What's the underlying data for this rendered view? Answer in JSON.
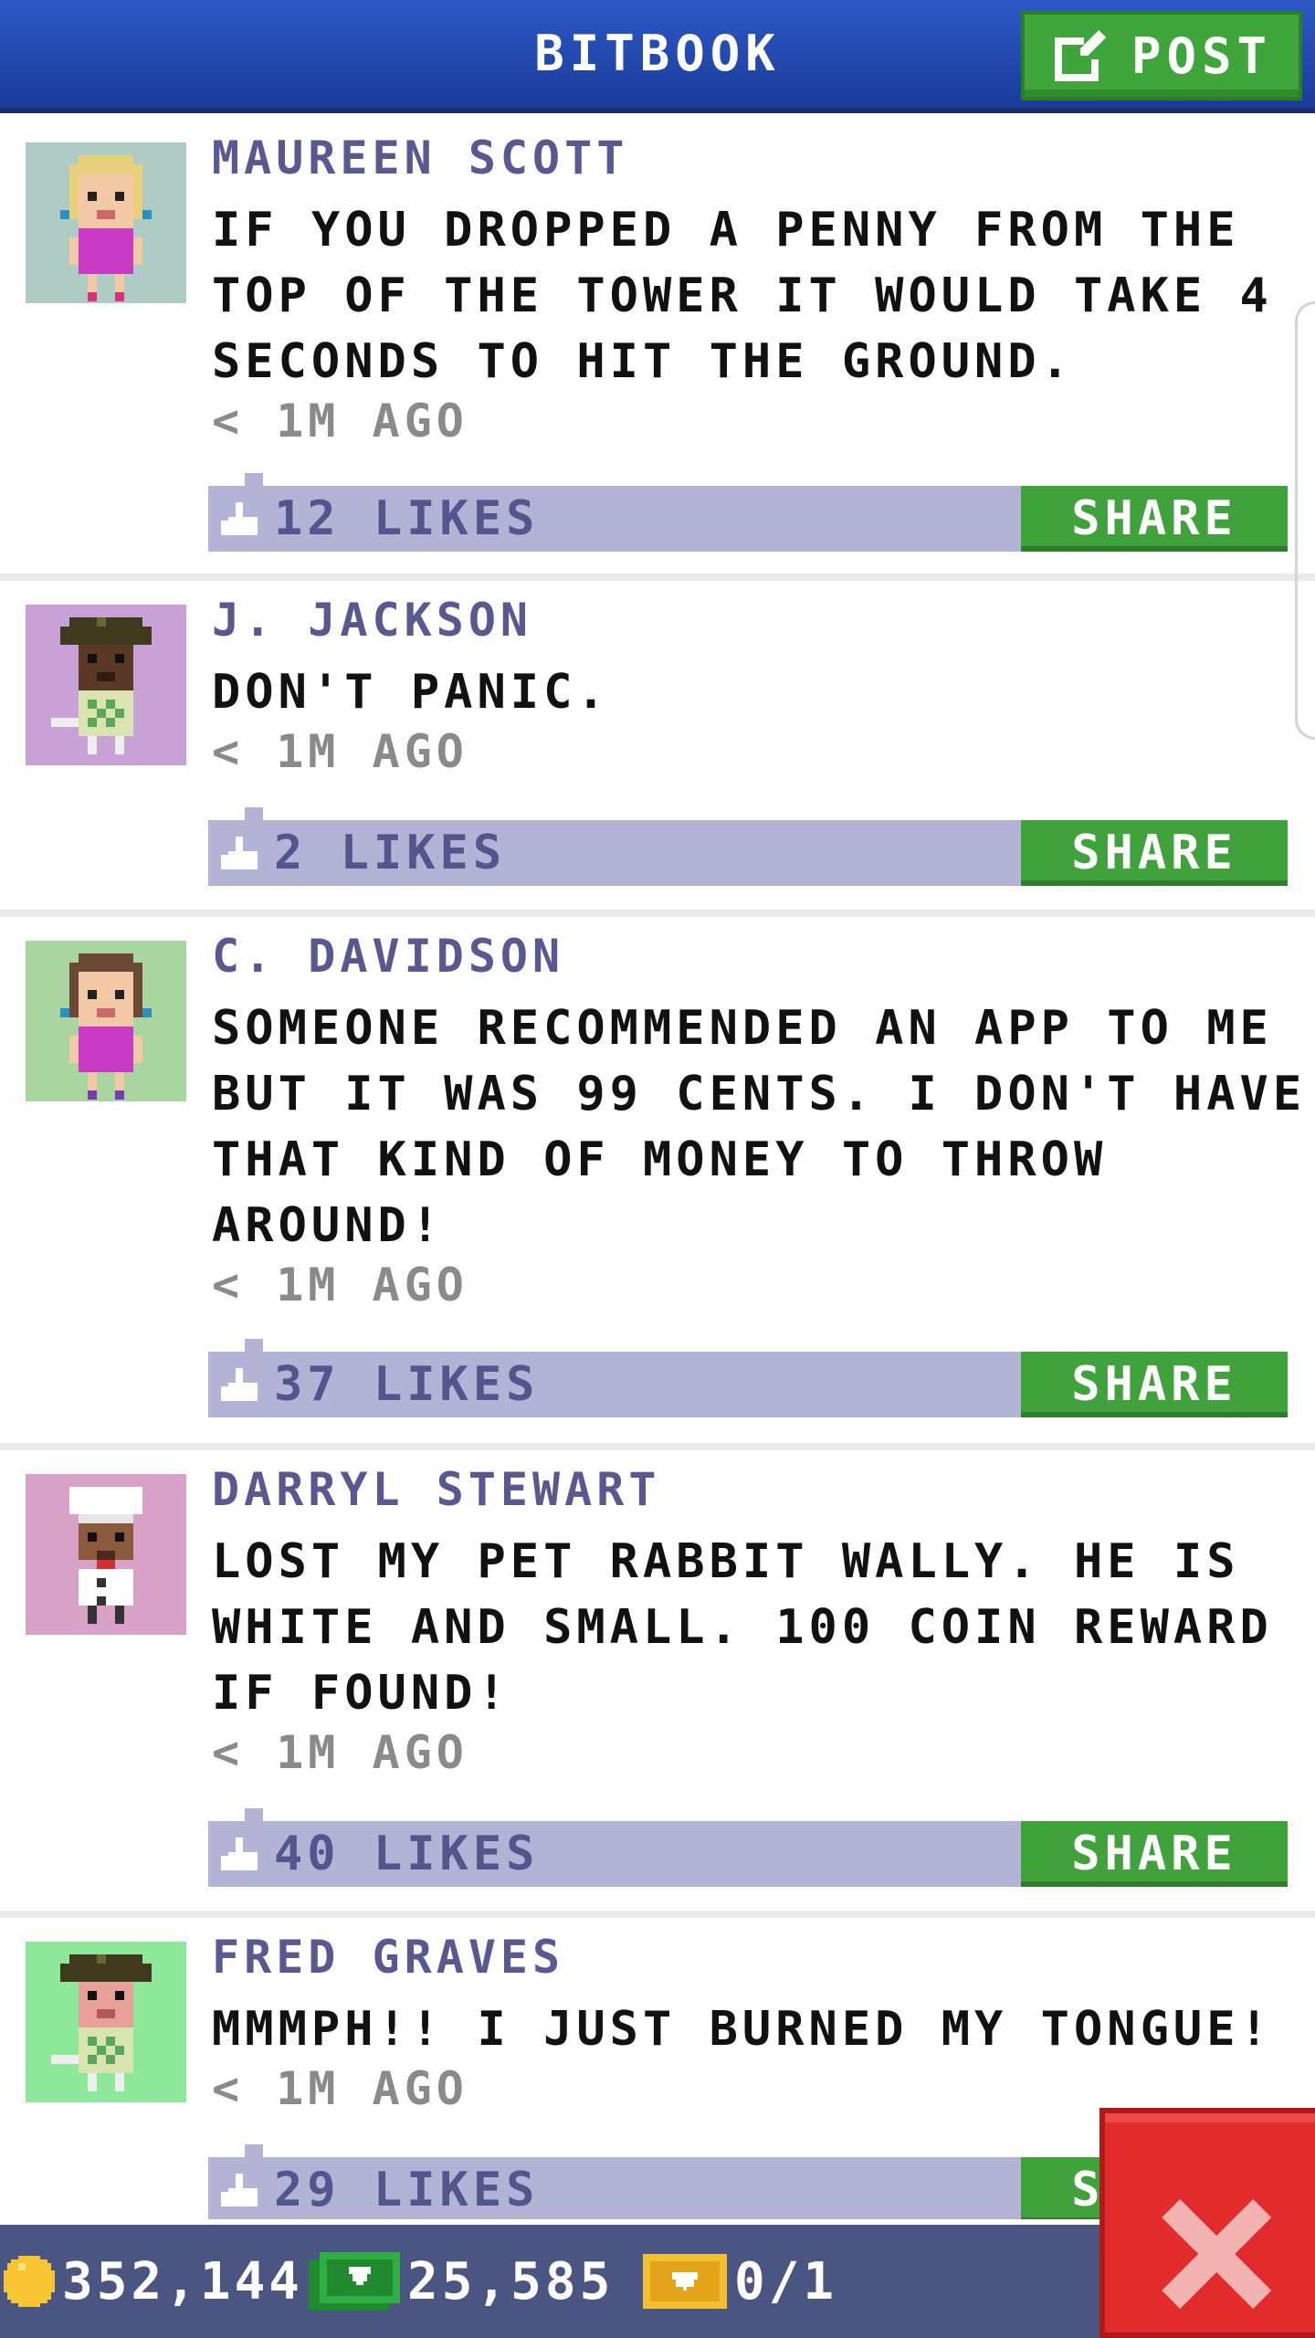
{
  "app": {
    "title": "BITBOOK",
    "post_label": "POST",
    "share_label": "SHARE"
  },
  "posts": [
    {
      "author": "MAUREEN SCOTT",
      "message": "IF YOU DROPPED A PENNY FROM THE TOP OF THE TOWER IT WOULD TAKE 4 SECONDS TO HIT THE GROUND.",
      "time": "< 1M AGO",
      "likes": "12 LIKES",
      "avatar_bg": "#afccc4"
    },
    {
      "author": "J. JACKSON",
      "message": "DON'T PANIC.",
      "time": "< 1M AGO",
      "likes": "2 LIKES",
      "avatar_bg": "#c8a2d6"
    },
    {
      "author": "C. DAVIDSON",
      "message": "SOMEONE RECOMMENDED AN APP TO ME BUT IT WAS 99 CENTS. I DON'T HAVE THAT KIND OF MONEY TO THROW AROUND!",
      "time": "< 1M AGO",
      "likes": "37 LIKES",
      "avatar_bg": "#a9d6a0"
    },
    {
      "author": "DARRYL STEWART",
      "message": "LOST MY PET RABBIT WALLY. HE IS WHITE AND SMALL. 100 COIN REWARD IF FOUND!",
      "time": "< 1M AGO",
      "likes": "40 LIKES",
      "avatar_bg": "#d8a2c6"
    },
    {
      "author": "FRED GRAVES",
      "message": "MMMPH!! I JUST BURNED MY TONGUE!",
      "time": "< 1M AGO",
      "likes": "29 LIKES",
      "avatar_bg": "#8ee89a"
    }
  ],
  "status": {
    "coins": "352,144",
    "bux": "25,585",
    "tickets": "0/1"
  },
  "icons": {
    "post": "edit-icon",
    "like": "thumb-up-icon",
    "close": "close-icon",
    "coin": "coin-icon",
    "bux": "bux-icon",
    "ticket": "ticket-icon"
  },
  "colors": {
    "header": "#2a53c2",
    "accent_green": "#3fa23b",
    "likes_bar": "#b2b3d5",
    "author_text": "#5a5891",
    "close_red": "#e22b2b",
    "status_bar": "#4b5582"
  }
}
